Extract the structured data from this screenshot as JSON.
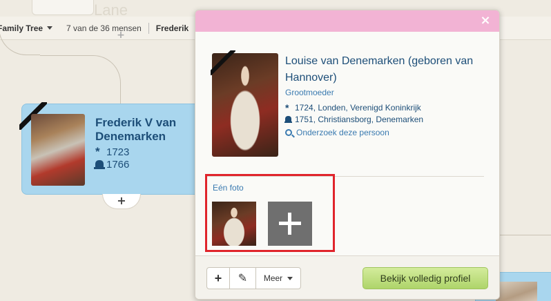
{
  "background": {
    "top_stub_text": "Lane",
    "toolbar": {
      "tree_label": "Family Tree",
      "count_label": "7 van de 36 mensen",
      "current_person": "Frederik"
    },
    "add_top_label": "+",
    "person_card": {
      "name": "Frederik V van Denemarken",
      "birth_year": "1723",
      "death_year": "1766",
      "add_label": "+"
    }
  },
  "popup": {
    "close_label": "×",
    "name": "Louise van Denemarken (geboren van Hannover)",
    "relation": "Grootmoeder",
    "birth": "1724, Londen, Verenigd Koninkrijk",
    "death": "1751, Christiansborg, Denemarken",
    "research_link": "Onderzoek deze persoon",
    "photos_label": "Eén foto",
    "footer": {
      "add_label": "+",
      "edit_label": "✎",
      "more_label": "Meer",
      "profile_button": "Bekijk volledig profiel"
    }
  },
  "icons": {
    "birth": "asterisk-icon",
    "death": "tombstone-icon",
    "research": "search-icon"
  },
  "colors": {
    "popup_header": "#f2b3d4",
    "card_bg": "#a9d6ee",
    "link": "#3a7ab0",
    "name": "#1d4e78",
    "highlight": "#e0242b",
    "profile_button": "#aed46a"
  }
}
